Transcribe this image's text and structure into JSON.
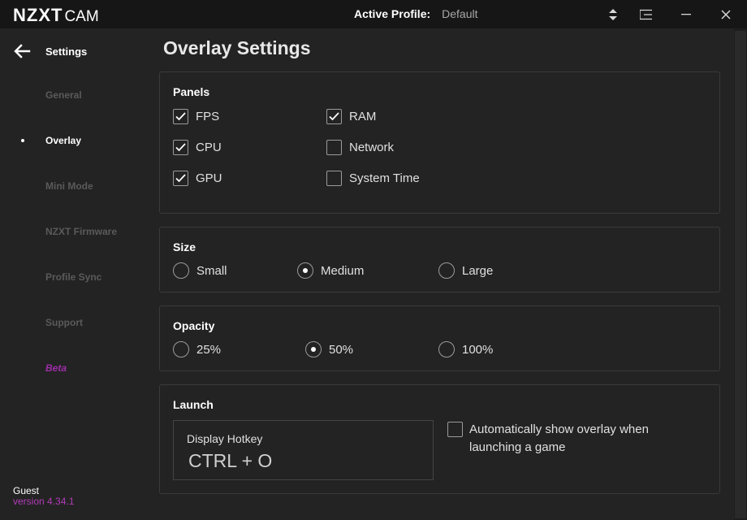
{
  "titlebar": {
    "brand_strong": "NZXT",
    "brand_light": "CAM",
    "profile_label": "Active Profile:",
    "profile_value": "Default",
    "icons": [
      "sort-arrows-icon",
      "menu-icon",
      "minimize-icon",
      "close-icon"
    ]
  },
  "sidebar": {
    "back_label": "Settings",
    "items": [
      {
        "label": "General",
        "active": false
      },
      {
        "label": "Overlay",
        "active": true
      },
      {
        "label": "Mini Mode",
        "active": false
      },
      {
        "label": "NZXT Firmware",
        "active": false
      },
      {
        "label": "Profile Sync",
        "active": false
      },
      {
        "label": "Support",
        "active": false
      },
      {
        "label": "Beta",
        "active": false
      }
    ],
    "user": "Guest",
    "version": "version 4.34.1"
  },
  "main": {
    "title": "Overlay Settings",
    "panels_section": {
      "title": "Panels",
      "items": [
        {
          "label": "FPS",
          "checked": true
        },
        {
          "label": "CPU",
          "checked": true
        },
        {
          "label": "GPU",
          "checked": true
        },
        {
          "label": "RAM",
          "checked": true
        },
        {
          "label": "Network",
          "checked": false
        },
        {
          "label": "System Time",
          "checked": false
        }
      ]
    },
    "size_section": {
      "title": "Size",
      "options": [
        "Small",
        "Medium",
        "Large"
      ],
      "selected": "Medium"
    },
    "opacity_section": {
      "title": "Opacity",
      "options": [
        "25%",
        "50%",
        "100%"
      ],
      "selected": "50%"
    },
    "launch_section": {
      "title": "Launch",
      "hotkey_label": "Display Hotkey",
      "hotkey_value": "CTRL + O",
      "auto_show_label": "Automatically show overlay when launching a game",
      "auto_show_checked": false
    }
  },
  "colors": {
    "background": "#232323",
    "titlebar": "#161616",
    "accent_purple": "#b23bb8",
    "border": "#3a3a3a"
  }
}
